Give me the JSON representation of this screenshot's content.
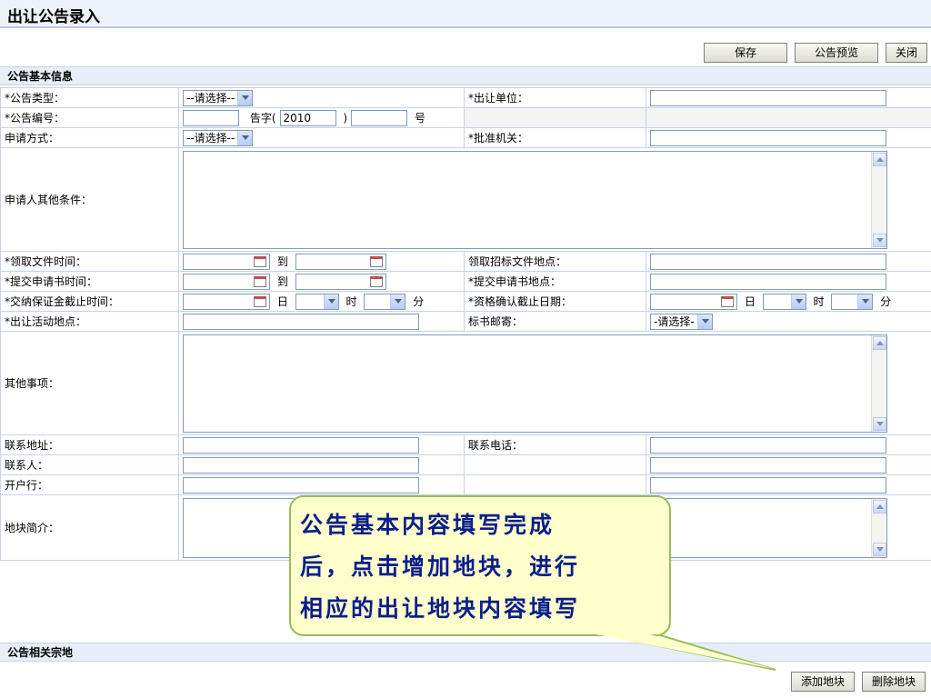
{
  "page": {
    "title": "出让公告录入"
  },
  "toolbar": {
    "save": "保存",
    "preview": "公告预览",
    "close": "关闭"
  },
  "sections": {
    "basic_info": "公告基本信息",
    "related_parcels": "公告相关宗地"
  },
  "fields": {
    "notice_type": {
      "label": "*公告类型：",
      "value": "--请选择--"
    },
    "seller": {
      "label": "*出让单位："
    },
    "notice_no": {
      "label": "*公告编号：",
      "gaozi": "告字(",
      "year": "2010",
      "close_paren": ")",
      "hao": "号"
    },
    "apply_method": {
      "label": "申请方式：",
      "value": "--请选择--"
    },
    "approver": {
      "label": "*批准机关："
    },
    "other_conditions": {
      "label": "申请人其他条件："
    },
    "doc_time": {
      "label": "*领取文件时间：",
      "to": "到"
    },
    "doc_place": {
      "label": "领取招标文件地点："
    },
    "submit_time": {
      "label": "*提交申请书时间：",
      "to": "到"
    },
    "submit_place": {
      "label": "*提交申请书地点："
    },
    "deposit_deadline": {
      "label": "*交纳保证金截止时间：",
      "day": "日",
      "hour": "时",
      "minute": "分"
    },
    "qual_deadline": {
      "label": "*资格确认截止日期：",
      "day": "日",
      "hour": "时",
      "minute": "分"
    },
    "activity_place": {
      "label": "*出让活动地点："
    },
    "mail": {
      "label": "标书邮寄：",
      "value": "-请选择-"
    },
    "other_matters": {
      "label": "其他事项："
    },
    "contact_address": {
      "label": "联系地址："
    },
    "contact_phone": {
      "label": "联系电话："
    },
    "contact_person": {
      "label": "联系人："
    },
    "bank": {
      "label": "开户行："
    },
    "parcel_intro": {
      "label": "地块简介："
    }
  },
  "callout": {
    "line1": "公告基本内容填写完成",
    "line2": "后，点击增加地块，进行",
    "line3": "相应的出让地块内容填写"
  },
  "parcel_buttons": {
    "add": "添加地块",
    "delete": "删除地块"
  }
}
